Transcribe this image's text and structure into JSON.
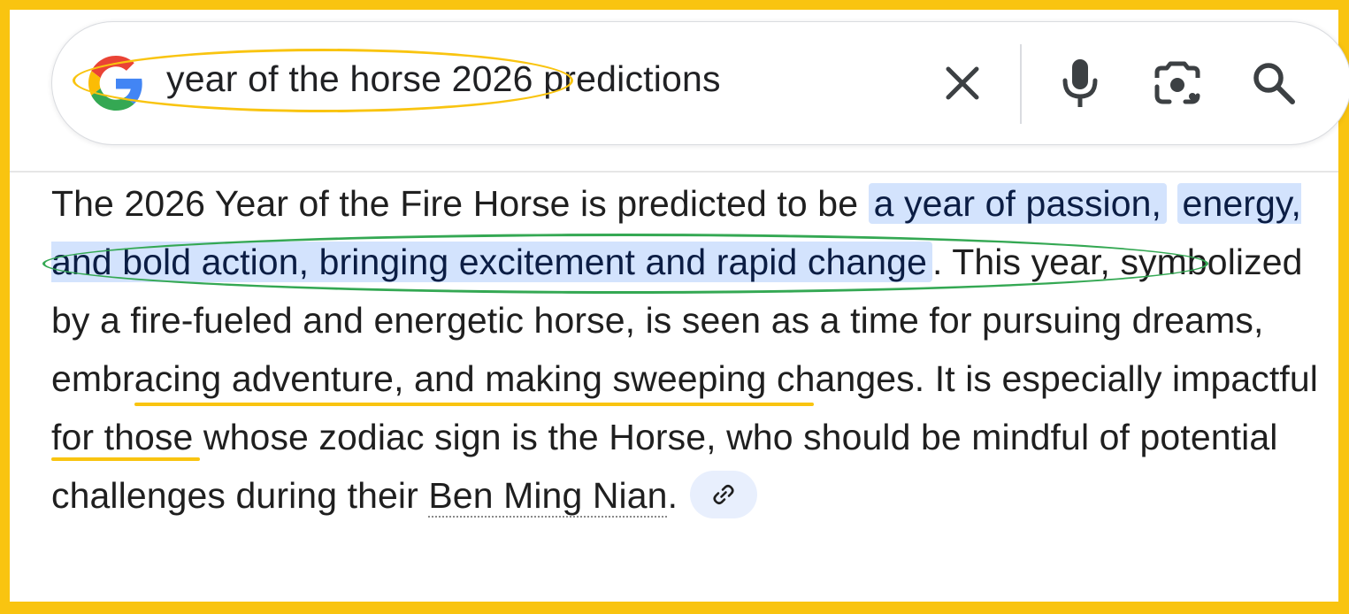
{
  "search": {
    "query": "year of the horse 2026 predictions",
    "clear_icon": "close-icon",
    "mic_icon": "microphone-icon",
    "lens_icon": "camera-lens-icon",
    "search_icon": "search-icon"
  },
  "overview": {
    "text_before_highlight": "The 2026 Year of the Fire Horse is predicted to be ",
    "highlight_line1": "a year of passion,",
    "highlight_line2": "energy, and bold action, bringing excitement and rapid change",
    "text_after_highlight": ". This year, symbolized by a fire-fueled and energetic horse, is seen as a time for pursuing dreams, embracing adventure, and making sweeping changes. It is especially impactful for those whose zodiac sign is the Horse, who should be mindful of potential challenges during their ",
    "term_link": "Ben Ming Nian",
    "ending": ".",
    "cite_icon": "link-icon"
  },
  "colors": {
    "annotation_yellow": "#f9c410",
    "annotation_green": "#34a853",
    "highlight_bg": "#d3e3fd"
  }
}
